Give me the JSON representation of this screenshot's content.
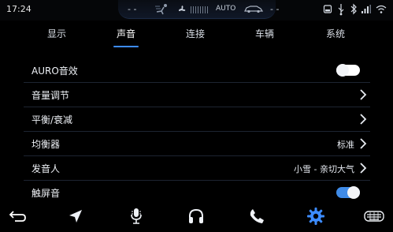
{
  "status_bar": {
    "time": "17:24",
    "fan_dash_left": "- -",
    "fan_dash_right": "- -",
    "auto_label": "AUTO",
    "icons": [
      "airflow-icon",
      "fan-icon",
      "car-icon",
      "window-icon",
      "usb-icon",
      "bluetooth-icon",
      "signal-icon",
      "wifi-icon"
    ]
  },
  "tabs": [
    {
      "label": "显示"
    },
    {
      "label": "声音",
      "active": true
    },
    {
      "label": "连接"
    },
    {
      "label": "车辆"
    },
    {
      "label": "系统"
    }
  ],
  "settings": {
    "auro": {
      "label": "AURO音效",
      "toggle": "off"
    },
    "volume": {
      "label": "音量调节"
    },
    "balance": {
      "label": "平衡/衰减"
    },
    "equalizer": {
      "label": "均衡器",
      "value": "标准"
    },
    "speaker": {
      "label": "发音人",
      "value": "小雪 - 亲切大气"
    },
    "touch_sound": {
      "label": "触屏音",
      "toggle": "on"
    }
  },
  "dock": {
    "icons": [
      "back-icon",
      "navigation-icon",
      "voice-icon",
      "headphones-icon",
      "phone-icon",
      "settings-icon",
      "car-grille-icon"
    ],
    "active": "settings-icon"
  },
  "colors": {
    "accent": "#3d8cff",
    "background": "#000000",
    "divider": "#1d2431"
  }
}
